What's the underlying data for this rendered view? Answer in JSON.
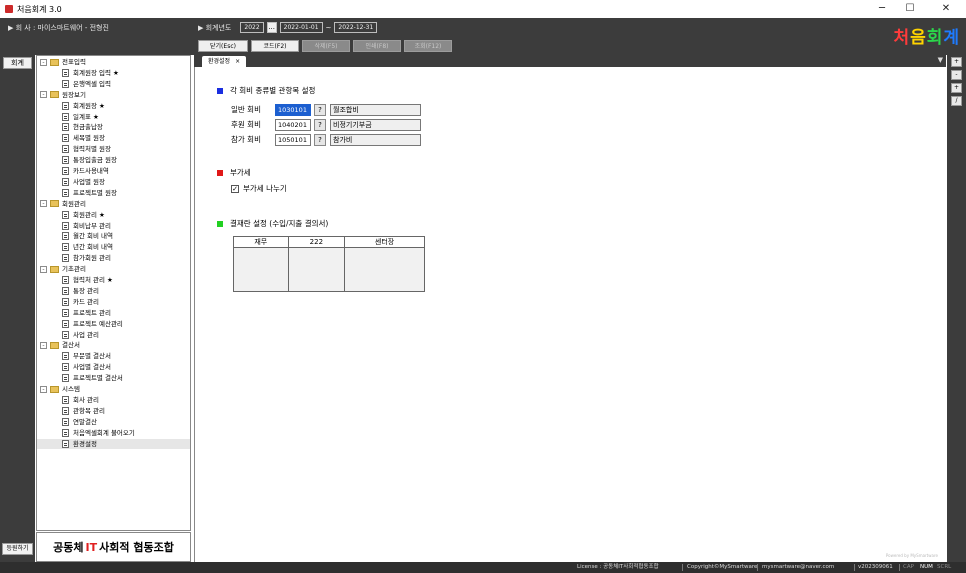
{
  "window": {
    "title": "처음회계 3.0"
  },
  "header": {
    "company_label": "▶ 회 사 : 마이스마트웨어 - 전형진",
    "fiscal_label": "▶ 회계년도",
    "fiscal_year": "2022",
    "fiscal_picker": "...",
    "date_from": "2022-01-01",
    "date_sep": "~",
    "date_to": "2022-12-31",
    "logo_chars": [
      "처",
      "음",
      "회",
      "계"
    ],
    "logo_colors": [
      "#ff3b3b",
      "#ffd400",
      "#2bd64b",
      "#1e7bff"
    ]
  },
  "toolbar": [
    {
      "label": "닫기(Esc)",
      "enabled": true
    },
    {
      "label": "코드(F2)",
      "enabled": true
    },
    {
      "label": "삭제(F5)",
      "enabled": false
    },
    {
      "label": "인쇄(F8)",
      "enabled": false
    },
    {
      "label": "조회(F12)",
      "enabled": false
    }
  ],
  "left_strip": {
    "accounting_button": "회계",
    "apply_button": "등원하기"
  },
  "tree": {
    "groups": [
      {
        "label": "전표입력",
        "items": [
          "회계원장 입력 ★",
          "은행엑셀 입력"
        ]
      },
      {
        "label": "원장보기",
        "items": [
          "회계원장 ★",
          "일계표 ★",
          "현금출납장",
          "세목별 원장",
          "협력처별 원장",
          "통장입출금 원장",
          "카드사용내역",
          "사업별 원장",
          "프로젝트별 원장"
        ]
      },
      {
        "label": "회원관리",
        "items": [
          "회원관리 ★",
          "회비납부 관리",
          "월간 회비 내역",
          "년간 회비 내역",
          "참가회원 관리"
        ]
      },
      {
        "label": "기초관리",
        "items": [
          "협력처 관리 ★",
          "통장 관리",
          "카드 관리",
          "프로젝트 관리",
          "프로젝트 예산관리",
          "사업 관리"
        ]
      },
      {
        "label": "결산서",
        "items": [
          "부문별 결산서",
          "사업별 결산서",
          "프로젝트별 결산서"
        ]
      },
      {
        "label": "시스템",
        "items": [
          "회사 관리",
          "관항목 관리",
          "연말결산",
          "처음엑셀회계 불어오기",
          "환경설정"
        ]
      }
    ],
    "selected": "환경설정"
  },
  "banner": {
    "part1": "공동체",
    "it": "IT",
    "part2": "사회적 협동조합"
  },
  "tab": {
    "label": "환경설정",
    "close": "×",
    "overflow": "▼"
  },
  "settings": {
    "section1_title": "각 회비 종류별 관항목 설정",
    "fees": [
      {
        "label": "일반 회비",
        "code": "1030101",
        "name": "월조합비"
      },
      {
        "label": "후원 회비",
        "code": "1040201",
        "name": "비정기기부금"
      },
      {
        "label": "참가 회비",
        "code": "1050101",
        "name": "참가비"
      }
    ],
    "lookup_button": "?",
    "section2_title": "부가세",
    "vat_checkbox": "부가세 나누기",
    "vat_checked": true,
    "section3_title": "결재란 설정 (수입/지출 결의서)",
    "approval_headers": [
      "재무",
      "222",
      "센터장"
    ],
    "colors": {
      "section1": "#1a2ee0",
      "section2": "#e01818",
      "section3": "#22d022"
    }
  },
  "powered_by": "Powered by MySmartware",
  "right_strip": [
    "+",
    "-",
    "+",
    "/"
  ],
  "status": {
    "license": "License : 공동체IT사회적협동조합",
    "copyright": "Copyright©MySmartware",
    "email": "mysmartware@naver.com",
    "version": "v202309061",
    "cap": "CAP",
    "num": "NUM",
    "scrl": "SCRL"
  }
}
